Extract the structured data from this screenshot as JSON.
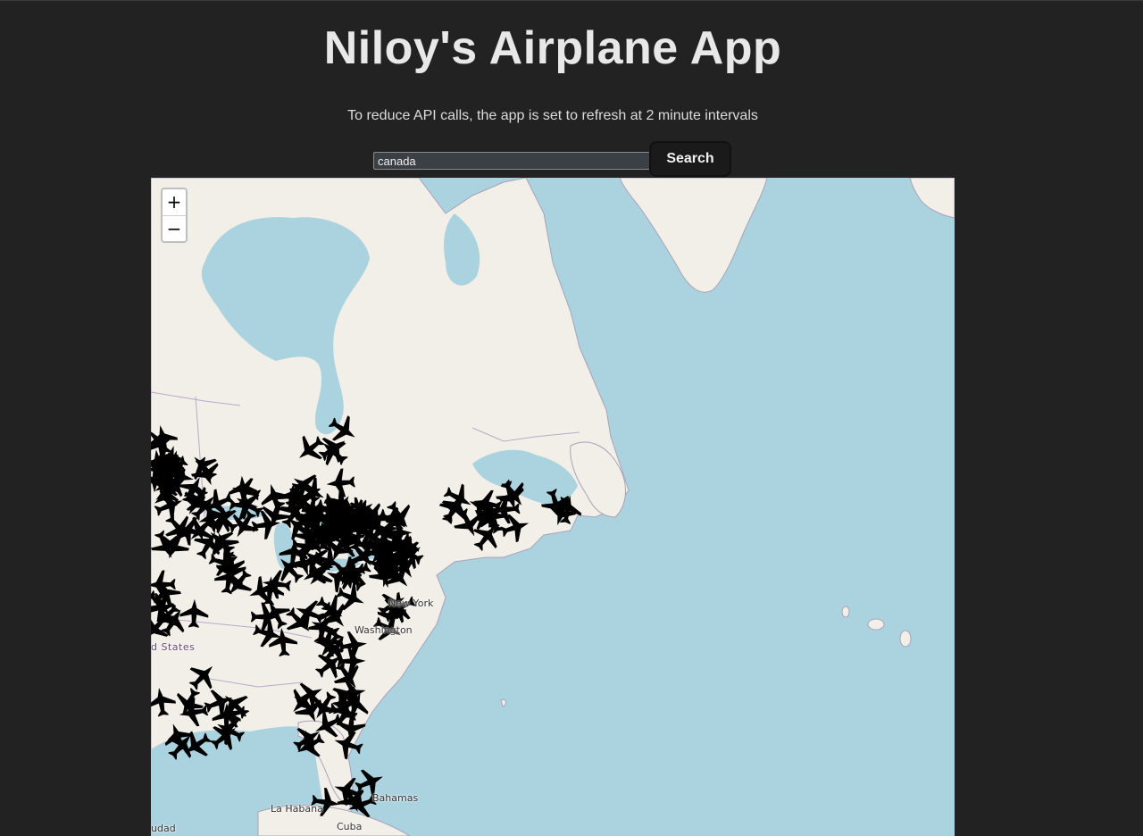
{
  "header": {
    "title": "Niloy's Airplane App",
    "subtitle": "To reduce API calls, the app is set to refresh at 2 minute intervals"
  },
  "search": {
    "value": "canada",
    "button_label": "Search"
  },
  "map": {
    "zoom_in_label": "+",
    "zoom_out_label": "−",
    "labels": {
      "us": "d States",
      "newyork": "New York",
      "washington": "Washington",
      "habana": "La Habana",
      "bahamas": "Bahamas",
      "cuba": "Cuba",
      "ciudad": "udad"
    },
    "colors": {
      "water": "#aad3df",
      "land": "#f2efe9",
      "border": "#b9a8c9",
      "plane": "#000000"
    },
    "marker_icon": "airplane-icon"
  }
}
